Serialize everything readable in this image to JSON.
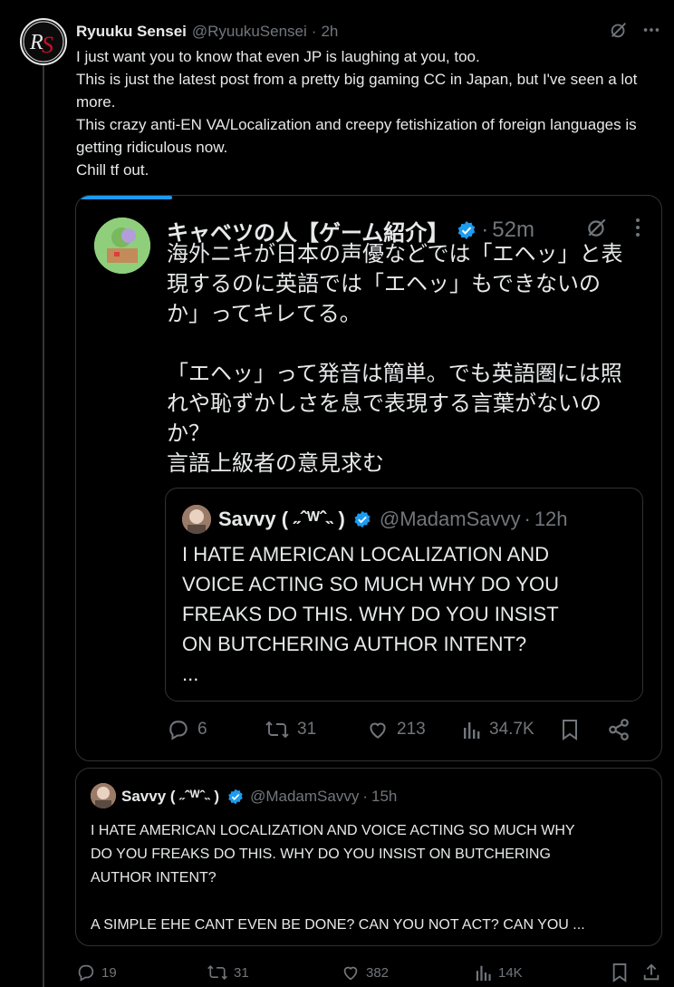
{
  "post": {
    "avatar_text": "RS",
    "name": "Ryuuku Sensei",
    "handle": "@RyuukuSensei",
    "dot": "·",
    "time": "2h",
    "lines": [
      "I just want you to know that even JP is laughing at you, too.",
      "This is just the latest post from a pretty big gaming CC in Japan, but I've seen a lot more.",
      "This crazy anti-EN VA/Localization and creepy fetishization of foreign languages is getting ridiculous now.",
      "Chill tf out."
    ],
    "actions": {
      "replies": "19",
      "reposts": "31",
      "likes": "382",
      "views": "14K"
    }
  },
  "quoted": {
    "name": "キャベツの人【ゲーム紹介】",
    "dot": "·",
    "time": "52m",
    "para1": [
      "海外ニキが日本の声優などでは「エヘッ」と表",
      "現するのに英語では「エヘッ」もできないの",
      "か」ってキレてる。"
    ],
    "para2": [
      "「エヘッ」って発音は簡単。でも英語圏には照",
      "れや恥ずかしさを息で表現する言葉がないの",
      "か？",
      "言語上級者の意見求む"
    ],
    "actions": {
      "replies": "6",
      "reposts": "31",
      "likes": "213",
      "views": "34.7K"
    },
    "inner": {
      "name": "Savvy ( ˶ˆᵂˆ˵ )",
      "handle": "@MadamSavvy",
      "dot": "·",
      "time": "12h",
      "lines": [
        "I HATE AMERICAN LOCALIZATION AND",
        "VOICE ACTING SO MUCH WHY DO YOU",
        "FREAKS DO THIS. WHY DO YOU INSIST",
        "ON BUTCHERING AUTHOR INTENT?",
        "..."
      ]
    }
  },
  "quoted2": {
    "name": "Savvy ( ˶ˆᵂˆ˵ )",
    "handle": "@MadamSavvy",
    "dot": "·",
    "time": "15h",
    "lines": [
      "I HATE AMERICAN LOCALIZATION AND VOICE ACTING SO MUCH WHY",
      "DO YOU FREAKS DO THIS. WHY DO YOU INSIST ON BUTCHERING",
      "AUTHOR INTENT?"
    ],
    "last_line": "A SIMPLE EHE CANT EVEN BE DONE? CAN YOU NOT ACT? CAN YOU ..."
  },
  "colors": {
    "background": "#000000",
    "text": "#e7e9ea",
    "muted": "#71767b",
    "border": "#2f3336",
    "accent": "#1d9bf0"
  },
  "icons": [
    "grok-icon",
    "more-icon",
    "verified-icon",
    "reply-icon",
    "repost-icon",
    "like-icon",
    "views-icon",
    "bookmark-icon",
    "share-icon"
  ]
}
